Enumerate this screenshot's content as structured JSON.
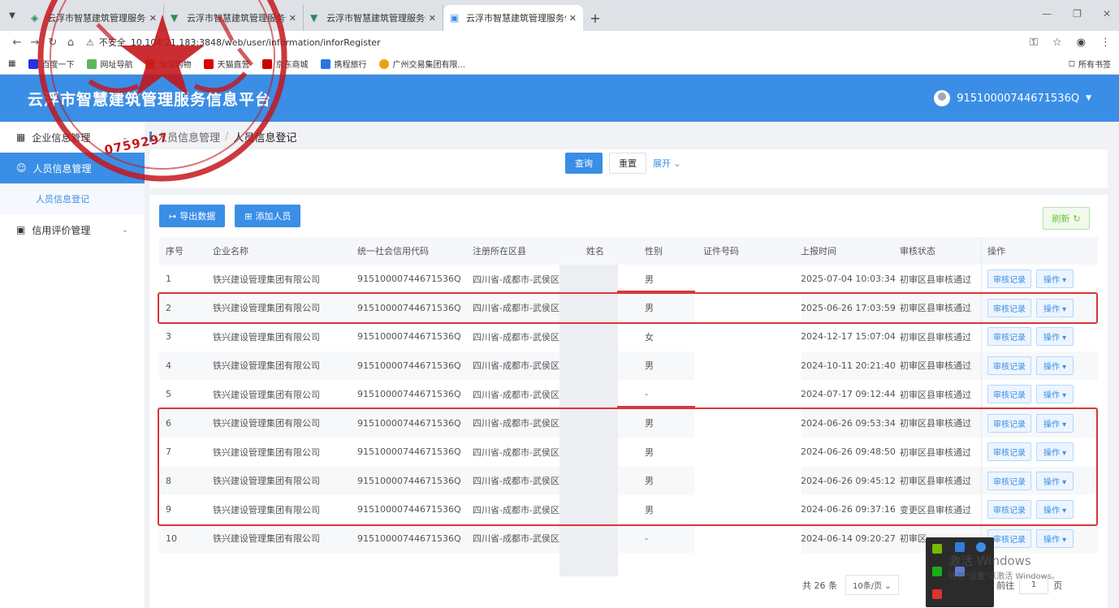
{
  "browser": {
    "tabs": [
      {
        "title": "云浮市智慧建筑管理服务信息平"
      },
      {
        "title": "云浮市智慧建筑管理服务信息平"
      },
      {
        "title": "云浮市智慧建筑管理服务信息平"
      },
      {
        "title": "云浮市智慧建筑管理服务信息平"
      }
    ],
    "url": "10.104.21.183:3848/web/user/information/inforRegister",
    "url_warning": "不安全",
    "bookmarks": [
      "百度一下",
      "网址导航",
      "淘宝购物",
      "天猫直营",
      "京东商城",
      "携程旅行",
      "广州交易集团有限..."
    ],
    "all_bookmarks": "所有书签"
  },
  "header": {
    "platform_title": "云浮市智慧建筑管理服务信息平台",
    "user_code": "91510000744671536Q"
  },
  "sidebar": {
    "items": [
      {
        "label": "企业信息管理"
      },
      {
        "label": "人员信息管理"
      },
      {
        "label": "人员信息登记"
      },
      {
        "label": "信用评价管理"
      }
    ]
  },
  "breadcrumb": {
    "parent": "人员信息管理",
    "separator": "/",
    "current": "人员信息登记"
  },
  "search": {
    "query_label": "查询",
    "reset_label": "重置",
    "expand_label": "展开"
  },
  "toolbar": {
    "export_label": "导出数据",
    "add_label": "添加人员",
    "refresh_label": "刷新"
  },
  "table": {
    "columns": [
      "序号",
      "企业名称",
      "统一社会信用代码",
      "注册所在区县",
      "姓名",
      "性别",
      "证件号码",
      "上报时间",
      "审核状态",
      "操作"
    ],
    "audit_label": "审核记录",
    "op_label": "操作",
    "rows": [
      {
        "no": "1",
        "company": "铁兴建设管理集团有限公司",
        "credit": "91510000744671536Q",
        "region": "四川省-成都市-武侯区",
        "gender": "男",
        "time": "2025-07-04 10:03:34",
        "status": "初审区县审核通过"
      },
      {
        "no": "2",
        "company": "铁兴建设管理集团有限公司",
        "credit": "91510000744671536Q",
        "region": "四川省-成都市-武侯区",
        "gender": "男",
        "time": "2025-06-26 17:03:59",
        "status": "初审区县审核通过"
      },
      {
        "no": "3",
        "company": "铁兴建设管理集团有限公司",
        "credit": "91510000744671536Q",
        "region": "四川省-成都市-武侯区",
        "gender": "女",
        "time": "2024-12-17 15:07:04",
        "status": "初审区县审核通过"
      },
      {
        "no": "4",
        "company": "铁兴建设管理集团有限公司",
        "credit": "91510000744671536Q",
        "region": "四川省-成都市-武侯区",
        "gender": "男",
        "time": "2024-10-11 20:21:40",
        "status": "初审区县审核通过"
      },
      {
        "no": "5",
        "company": "铁兴建设管理集团有限公司",
        "credit": "91510000744671536Q",
        "region": "四川省-成都市-武侯区",
        "gender": "-",
        "time": "2024-07-17 09:12:44",
        "status": "初审区县审核通过"
      },
      {
        "no": "6",
        "company": "铁兴建设管理集团有限公司",
        "credit": "91510000744671536Q",
        "region": "四川省-成都市-武侯区",
        "gender": "男",
        "time": "2024-06-26 09:53:34",
        "status": "初审区县审核通过"
      },
      {
        "no": "7",
        "company": "铁兴建设管理集团有限公司",
        "credit": "91510000744671536Q",
        "region": "四川省-成都市-武侯区",
        "gender": "男",
        "time": "2024-06-26 09:48:50",
        "status": "初审区县审核通过"
      },
      {
        "no": "8",
        "company": "铁兴建设管理集团有限公司",
        "credit": "91510000744671536Q",
        "region": "四川省-成都市-武侯区",
        "gender": "男",
        "time": "2024-06-26 09:45:12",
        "status": "初审区县审核通过"
      },
      {
        "no": "9",
        "company": "铁兴建设管理集团有限公司",
        "credit": "91510000744671536Q",
        "region": "四川省-成都市-武侯区",
        "gender": "男",
        "time": "2024-06-26 09:37:16",
        "status": "变更区县审核通过"
      },
      {
        "no": "10",
        "company": "铁兴建设管理集团有限公司",
        "credit": "91510000744671536Q",
        "region": "四川省-成都市-武侯区",
        "gender": "-",
        "time": "2024-06-14 09:20:27",
        "status": "初审区"
      }
    ]
  },
  "pager": {
    "total": "共 26 条",
    "page_size": "10条/页",
    "goto_label": "前往",
    "page": "1",
    "page_unit": "页"
  },
  "os_overlay": {
    "activation_title": "激活 Windows",
    "activation_sub": "转到\"设置\"以激活 Windows。"
  },
  "stamp": {
    "digits": "0759297"
  },
  "colors": {
    "brand_blue": "#3a8ee6",
    "highlight_red": "#d8363a",
    "stamp_red": "#c4161c"
  }
}
